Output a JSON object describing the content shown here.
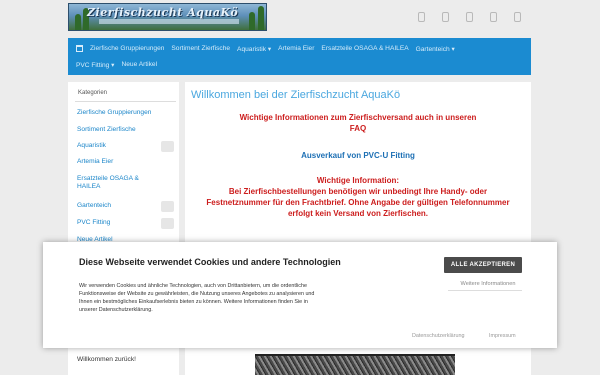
{
  "header": {
    "logo_text": "Zierfischzucht AquaKö",
    "icons": [
      "user-icon",
      "heart-icon",
      "compare-icon",
      "cart-icon",
      "menu-icon"
    ]
  },
  "nav": {
    "row1": [
      "Zierfische Gruppierungen",
      "Sortiment Zierfische",
      "Aquaristik ▾",
      "Artemia Eier",
      "Ersatzteile OSAGA & HAILEA",
      "Gartenteich ▾"
    ],
    "row2": [
      "PVC Fitting ▾",
      "Neue Artikel"
    ]
  },
  "sidebar": {
    "title": "Kategorien",
    "items": [
      {
        "label": "Zierfische Gruppierungen"
      },
      {
        "label": "Sortiment Zierfische"
      },
      {
        "label": "Aquaristik"
      },
      {
        "label": "Artemia Eier"
      },
      {
        "label": "Ersatzteile OSAGA & HAILEA"
      },
      {
        "label": "Gartenteich"
      },
      {
        "label": "PVC Fitting"
      },
      {
        "label": "Neue Artikel"
      }
    ],
    "welcome_back": "Willkommen zurück!"
  },
  "main": {
    "welcome": "Willkommen bei der Zierfischzucht AquaKö",
    "info_link": "Wichtige Informationen zum Zierfischversand auch in unseren FAQ",
    "sale": "Ausverkauf von PVC-U Fitting",
    "notice_title": "Wichtige Information:",
    "notice_body": "Bei Zierfischbestellungen benötigen wir unbedingt Ihre Handy- oder Festnetznummer für den Frachtbrief. Ohne Angabe der gültigen Telefonnummer erfolgt kein Versand von Zierfischen."
  },
  "cookie": {
    "title": "Diese Webseite verwendet Cookies und andere Technologien",
    "text": "Wir verwenden Cookies und ähnliche Technologien, auch von Drittanbietern, um die ordentliche Funktionsweise der Website zu gewährleisten, die Nutzung unseres Angebotes zu analysieren und Ihnen ein bestmögliches Einkaufserlebnis bieten zu können. Weitere Informationen finden Sie in unserer Datenschutzerklärung.",
    "accept": "ALLE AKZEPTIEREN",
    "more": "Weitere Informationen",
    "privacy": "Datenschutzerklärung",
    "imprint": "Impressum"
  }
}
